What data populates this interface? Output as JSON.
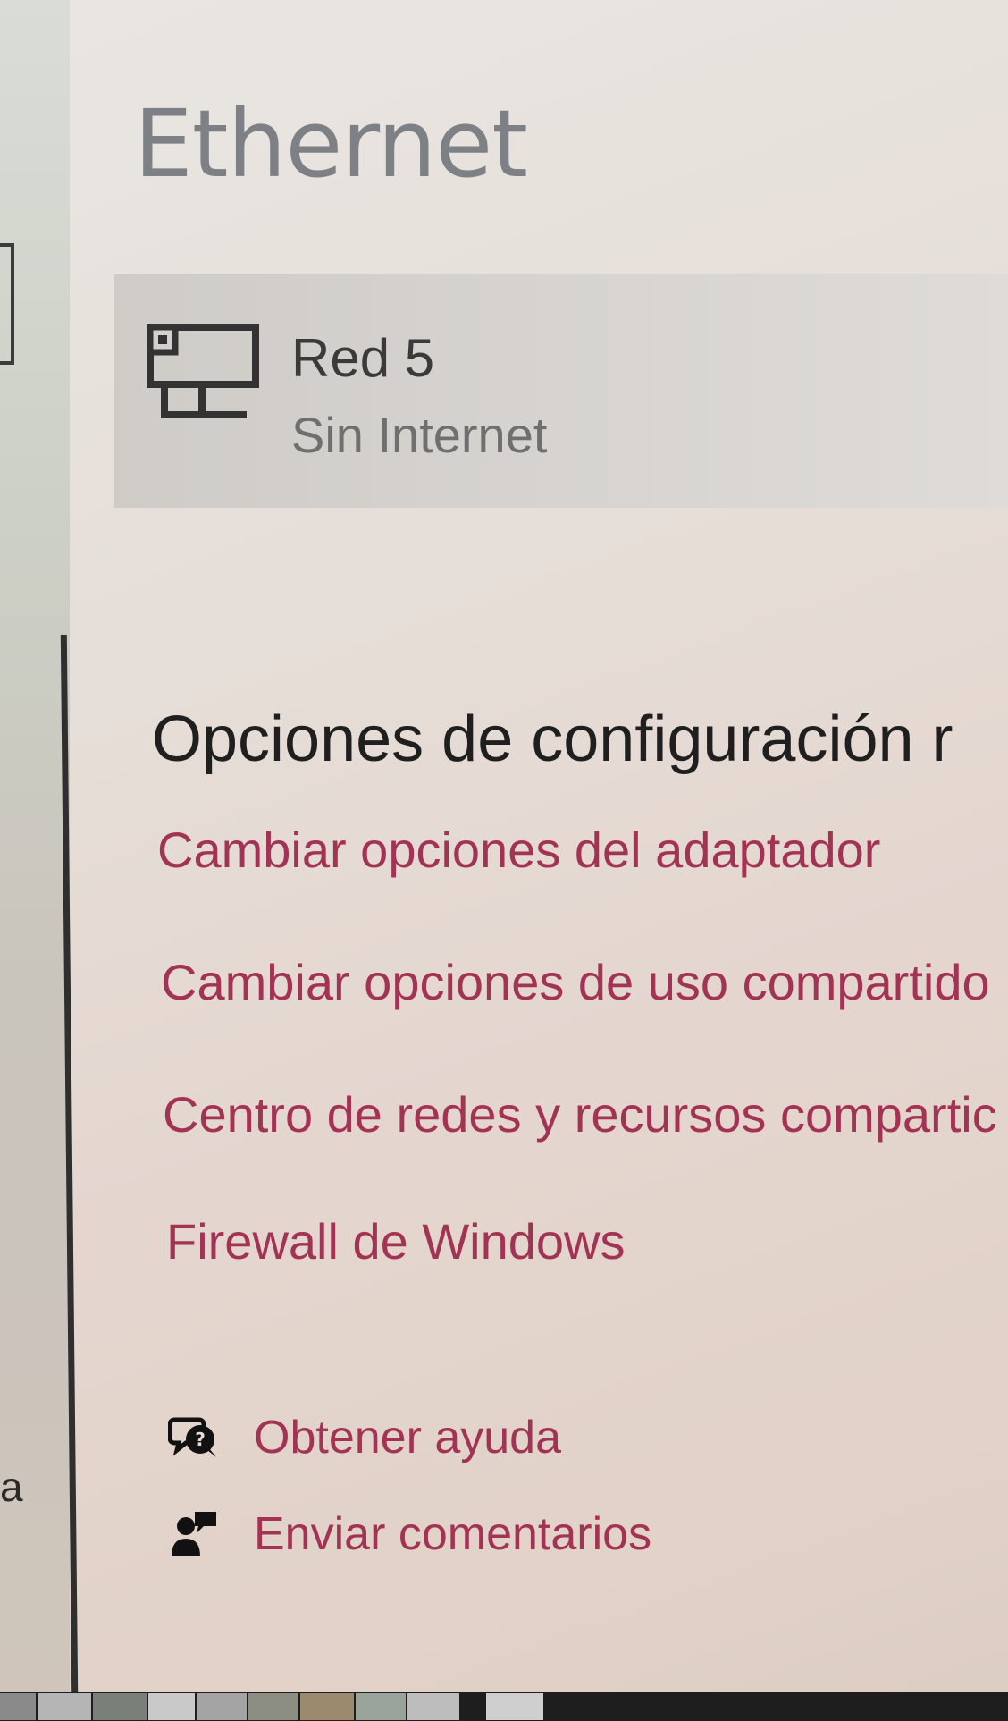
{
  "header": {
    "title": "Ethernet"
  },
  "network": {
    "name": "Red 5",
    "status": "Sin Internet",
    "icon": "network-monitor-icon"
  },
  "related": {
    "heading": "Opciones de configuración r",
    "links": [
      "Cambiar opciones del adaptador",
      "Cambiar opciones de uso compartido",
      "Centro de redes y recursos compartic",
      "Firewall de Windows"
    ]
  },
  "support": {
    "help_label": "Obtener ayuda",
    "help_icon": "help-chat-icon",
    "feedback_label": "Enviar comentarios",
    "feedback_icon": "feedback-person-icon"
  },
  "left_pane": {
    "partial_text": "a"
  },
  "colors": {
    "link": "#a23354",
    "title": "#7d8185",
    "heading": "#1f1f1f",
    "card": "#d3d0cd"
  }
}
